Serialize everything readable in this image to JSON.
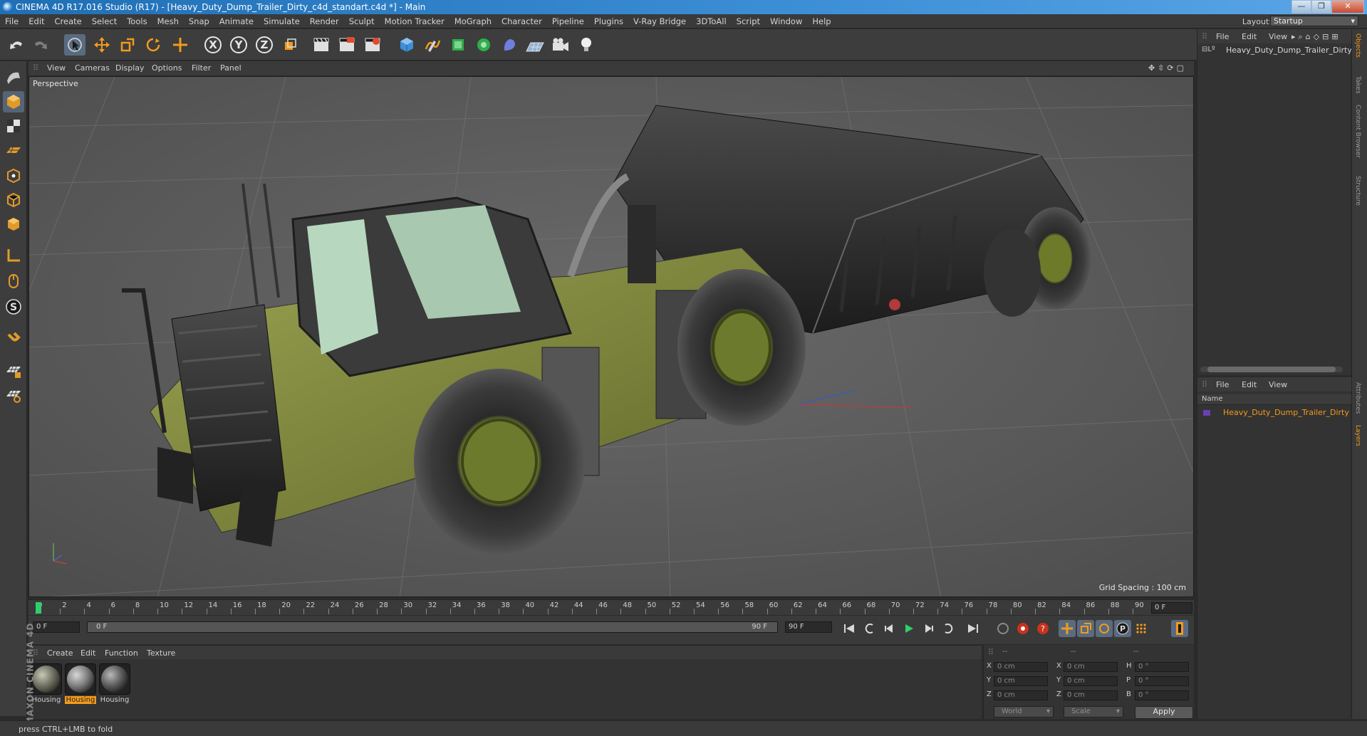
{
  "window": {
    "title": "CINEMA 4D R17.016 Studio (R17) - [Heavy_Duty_Dump_Trailer_Dirty_c4d_standart.c4d *] - Main",
    "controls": [
      "—",
      "❐",
      "✕"
    ]
  },
  "menubar": {
    "items": [
      "File",
      "Edit",
      "Create",
      "Select",
      "Tools",
      "Mesh",
      "Snap",
      "Animate",
      "Simulate",
      "Render",
      "Sculpt",
      "Motion Tracker",
      "MoGraph",
      "Character",
      "Pipeline",
      "Plugins",
      "V-Ray Bridge",
      "3DToAll",
      "Script",
      "Window",
      "Help"
    ],
    "layout_label": "Layout:",
    "layout_value": "Startup"
  },
  "toolbar": {
    "axis_x": "X",
    "axis_y": "Y",
    "axis_z": "Z"
  },
  "viewport": {
    "menu": [
      "View",
      "Cameras",
      "Display",
      "Options",
      "Filter",
      "Panel"
    ],
    "label": "Perspective",
    "grid_spacing": "Grid Spacing : 100 cm"
  },
  "timeline": {
    "ticks": [
      "0",
      "2",
      "4",
      "6",
      "8",
      "10",
      "12",
      "14",
      "16",
      "18",
      "20",
      "22",
      "24",
      "26",
      "28",
      "30",
      "32",
      "34",
      "36",
      "38",
      "40",
      "42",
      "44",
      "46",
      "48",
      "50",
      "52",
      "54",
      "56",
      "58",
      "60",
      "62",
      "64",
      "66",
      "68",
      "70",
      "72",
      "74",
      "76",
      "78",
      "80",
      "82",
      "84",
      "86",
      "88",
      "90"
    ],
    "current_frame": "0 F",
    "start_field": "0 F",
    "range_start": "0 F",
    "range_end": "90 F",
    "end_field": "90 F"
  },
  "materials": {
    "menu": [
      "Create",
      "Edit",
      "Function",
      "Texture"
    ],
    "items": [
      {
        "label": "Housing",
        "selected": false
      },
      {
        "label": "Housing",
        "selected": true
      },
      {
        "label": "Housing",
        "selected": false
      }
    ]
  },
  "coords": {
    "header": [
      "--",
      "--",
      "--"
    ],
    "rows": [
      {
        "a": "X",
        "av": "0 cm",
        "b": "X",
        "bv": "0 cm",
        "c": "H",
        "cv": "0 °"
      },
      {
        "a": "Y",
        "av": "0 cm",
        "b": "Y",
        "bv": "0 cm",
        "c": "P",
        "cv": "0 °"
      },
      {
        "a": "Z",
        "av": "0 cm",
        "b": "Z",
        "bv": "0 cm",
        "c": "B",
        "cv": "0 °"
      }
    ],
    "mode": "World",
    "transform": "Scale",
    "apply": "Apply"
  },
  "objects": {
    "menu": [
      "File",
      "Edit",
      "View"
    ],
    "item": "Heavy_Duty_Dump_Trailer_Dirty"
  },
  "layers": {
    "menu": [
      "File",
      "Edit",
      "View"
    ],
    "column": "Name",
    "item": "Heavy_Duty_Dump_Trailer_Dirty",
    "item_color": "#f29b1c"
  },
  "side_tabs": [
    "Objects",
    "Takes",
    "Content Browser",
    "Structure",
    "Attributes",
    "Layers"
  ],
  "status": "press CTRL+LMB to fold",
  "brand": {
    "logo": "MAXON CINEMA 4D"
  },
  "colors": {
    "accent": "#f29b1c",
    "highlight": "#5a6b80",
    "bg": "#2b2b2b"
  }
}
